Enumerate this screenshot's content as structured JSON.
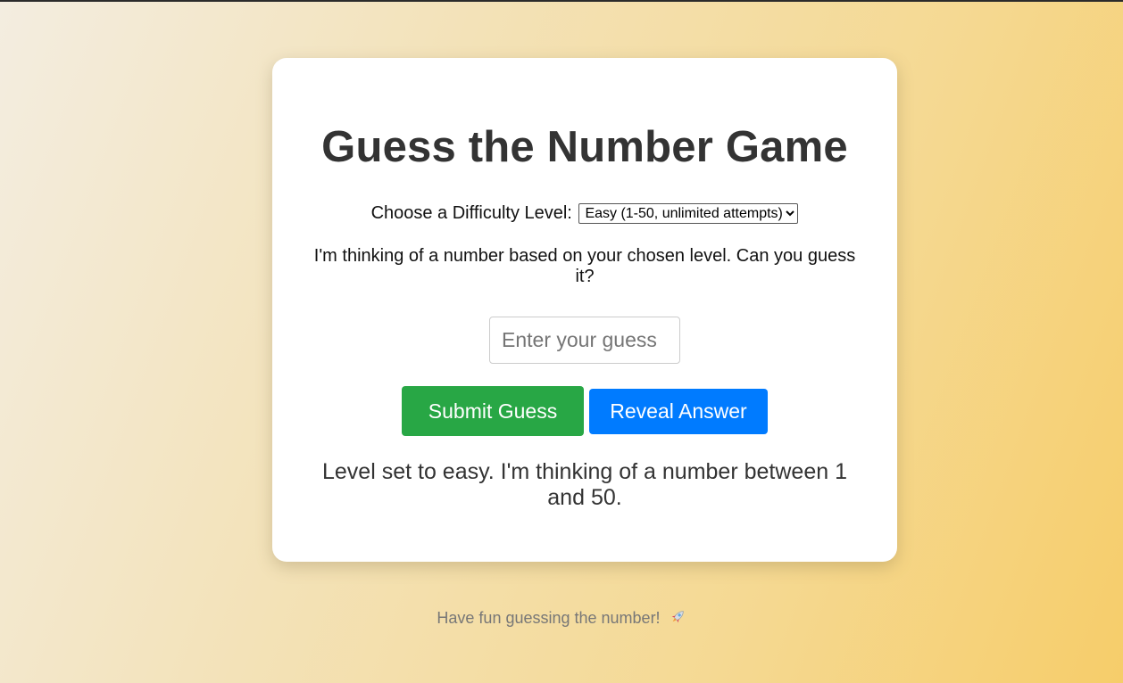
{
  "game": {
    "title": "Guess the Number Game",
    "level_label": "Choose a Difficulty Level:",
    "level_selected": "Easy (1-50, unlimited attempts)",
    "intro": "I'm thinking of a number based on your chosen level. Can you guess it?",
    "guess_placeholder": "Enter your guess",
    "guess_value": "",
    "submit_label": "Submit Guess",
    "reveal_label": "Reveal Answer",
    "message": "Level set to easy. I'm thinking of a number between 1 and 50."
  },
  "footer": {
    "text": "Have fun guessing the number!",
    "icon": "rocket-icon"
  },
  "colors": {
    "submit_button": "#28a745",
    "reveal_button": "#007bff",
    "card_background": "#ffffff",
    "background_gradient_start": "#f3ede0",
    "background_gradient_end": "#f6cd6a"
  }
}
